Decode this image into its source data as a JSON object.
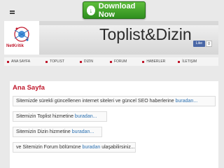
{
  "download": {
    "label": "Download Now"
  },
  "header": {
    "logo_text": "NetKritik",
    "site_title": "Toplist&Dizin",
    "fb_like": "Like",
    "fb_count": "0"
  },
  "nav": [
    {
      "label": "ANA SAYFA"
    },
    {
      "label": "TOPLIST"
    },
    {
      "label": "DIZIN"
    },
    {
      "label": "FORUM"
    },
    {
      "label": "HABERLER"
    },
    {
      "label": "İLETIŞIM"
    }
  ],
  "content": {
    "title": "Ana Sayfa",
    "rows": [
      {
        "text": "Sitemizde sürekli güncellenen internet siteleri ve güncel SEO haberlerine",
        "link": "buradan...",
        "after": ""
      },
      {
        "text": "Sitemizin Toplist hizmetine",
        "link": "buradan...",
        "after": ""
      },
      {
        "text": "Sitemizin Dizin hizmetine",
        "link": "buradan...",
        "after": ""
      },
      {
        "text": "ve Sitemizin Forum bölümüne",
        "link": "buradan",
        "after": " ulaşabilirsiniz..."
      }
    ]
  },
  "colors": {
    "accent": "#c0182c",
    "link": "#2a6fb0",
    "download": "#3fa02a"
  }
}
